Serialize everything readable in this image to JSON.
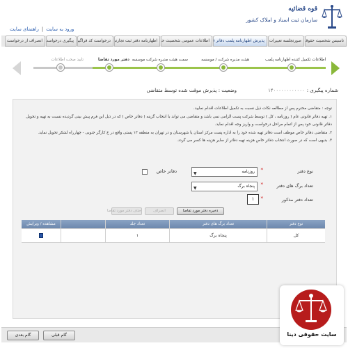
{
  "header": {
    "org_title": "قوه قضائیه",
    "org_name": "سازمان ثبت اسناد و املاک کشور",
    "links": [
      "ورود به سایت",
      "راهنمای سایت"
    ]
  },
  "nav": {
    "items": [
      "تاسیس شخصیت حقوقی",
      "صورتجلسه تغییرات",
      "پذیرش اظهارنامه پلمب دفاتر قانونی",
      "اطلاعات عمومی شخصیت حقوقی",
      "اظهارنامه دفتر ثبت تجارتی",
      "درخواست کد فراگیر",
      "پیگیری درخواست",
      "انصراف از درخواست"
    ],
    "active_index": 2
  },
  "wizard": {
    "steps": [
      "اطلاعات تکمیل کننده اظهارنامه پلمب",
      "هیئت مدیره شرکت / موسسه",
      "سمت هیئت مدیره شرکت موسسه",
      "دفتر مورد تقاضا",
      "تایید صحت اطلاعات"
    ],
    "current_step": 3,
    "colors": {
      "done": "#8ab83a",
      "todo": "#c4c4c4"
    }
  },
  "tracking": {
    "label": "شماره پیگیری :",
    "number": "۱۴۰۰۰۰۰۰۰۰۰۰۰۰",
    "status": "وضعیت : پذیرش موقت شده توسط متقاضی"
  },
  "notes": {
    "lines": [
      "توجه : متقاضی محترم پس از مطالعه نکات ذیل نسبت به تکمیل اطلاعات اقدام نمایید.",
      "۱. تهیه دفاتر قانونی عام ( روزنامه ، کل ) توسط شرکت پست الزامی نمی باشد و متقاضی می تواند با انتخاب گزینه ( دفاتر خاص ) که در ذیل این فرم پیش بینی گردیده نسبت به تهیه و تحویل",
      "دفاتر قانونی خود پس از اتمام مراحل درخواست و واریز وجه اقدام نماید.",
      "۲. متقاضی دفاتر خاص موظف است دفاتر تهیه شده خود را به اداره پست مرکز استان یا شهرستان و در تهران به منطقه ۱۳ پستی واقع در خ کارگر جنوبی - چهارراه لشکر تحویل نماید.",
      "۳. بدیهی است که در صورت انتخاب دفاتر خاص هزینه تهیه دفاتر از سایر هزینه ها کسر می گردد."
    ]
  },
  "form": {
    "book_type_label": "نوع دفتر",
    "book_type_value": "روزنامه",
    "pages_label": "تعداد برگ های دفتر",
    "pages_value": "پنجاه برگ",
    "qty_label": "تعداد دفتر مذکور",
    "qty_value": "۱",
    "special_label": "دفاتر خاص",
    "special_checked": false
  },
  "buttons": {
    "save": "ذخیره دفتر مورد تقاضا",
    "cancel": "انصراف",
    "delete": "حذف دفتر مورد تقاضا"
  },
  "table": {
    "headers": [
      "نوع دفتر",
      "تعداد برگ های دفتر",
      "تعداد جلد",
      "مشاهده / ویرایش"
    ],
    "rows": [
      {
        "type": "کل",
        "pages": "پنجاه برگ",
        "count": "۱"
      }
    ]
  },
  "footer": {
    "prev": "گام قبلی",
    "next": "گام بعدی"
  },
  "watermark": {
    "text": "سایت حقوقی دینا"
  }
}
